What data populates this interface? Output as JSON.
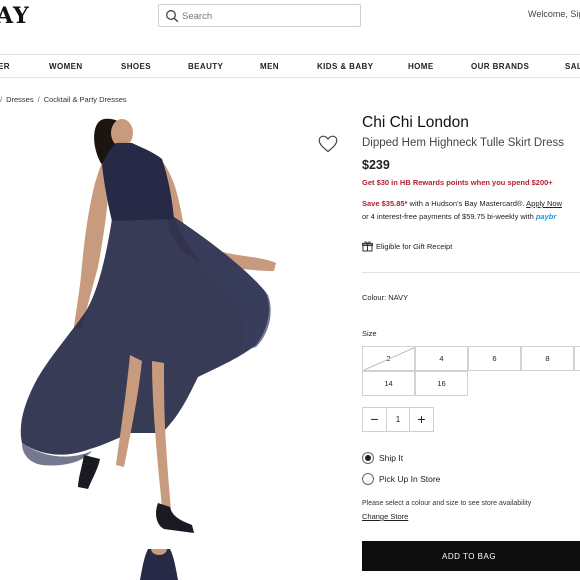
{
  "header": {
    "logo": "AY",
    "search": {
      "placeholder": "Search"
    },
    "welcome": "Welcome, Sig"
  },
  "nav": [
    "ER",
    "WOMEN",
    "SHOES",
    "BEAUTY",
    "MEN",
    "KIDS & BABY",
    "HOME",
    "OUR BRANDS",
    "SAL"
  ],
  "breadcrumb": [
    "/",
    "Dresses",
    "/",
    "Cocktail & Party Dresses"
  ],
  "product": {
    "brand": "Chi Chi London",
    "name": "Dipped Hem Highneck Tulle Skirt Dress",
    "price": "$239",
    "rewards": "Get $30 in HB Rewards points when you spend $200+",
    "save_prefix": "Save ",
    "save_amount": "$35.85*",
    "save_text": " with a Hudson's Bay Mastercard®. ",
    "apply_link": "Apply Now",
    "installments_text": "or 4 interest-free payments of $59.75 bi-weekly with ",
    "paybright": "paybr",
    "gift_receipt": "Eligible for Gift Receipt",
    "colour": "Colour: NAVY",
    "size_label": "Size",
    "sizes": [
      "2",
      "4",
      "6",
      "8",
      "14",
      "16"
    ],
    "quantity": "1",
    "shipping_options": [
      "Ship It",
      "Pick Up In Store"
    ],
    "selected_shipping": "Ship It",
    "store_note": "Please select a colour and size to see store availability",
    "change_store": "Change Store",
    "add_to_bag": "ADD TO BAG"
  },
  "colors": {
    "dress": "#262a47",
    "accent_red": "#b3202f",
    "button": "#0d0d0d"
  }
}
